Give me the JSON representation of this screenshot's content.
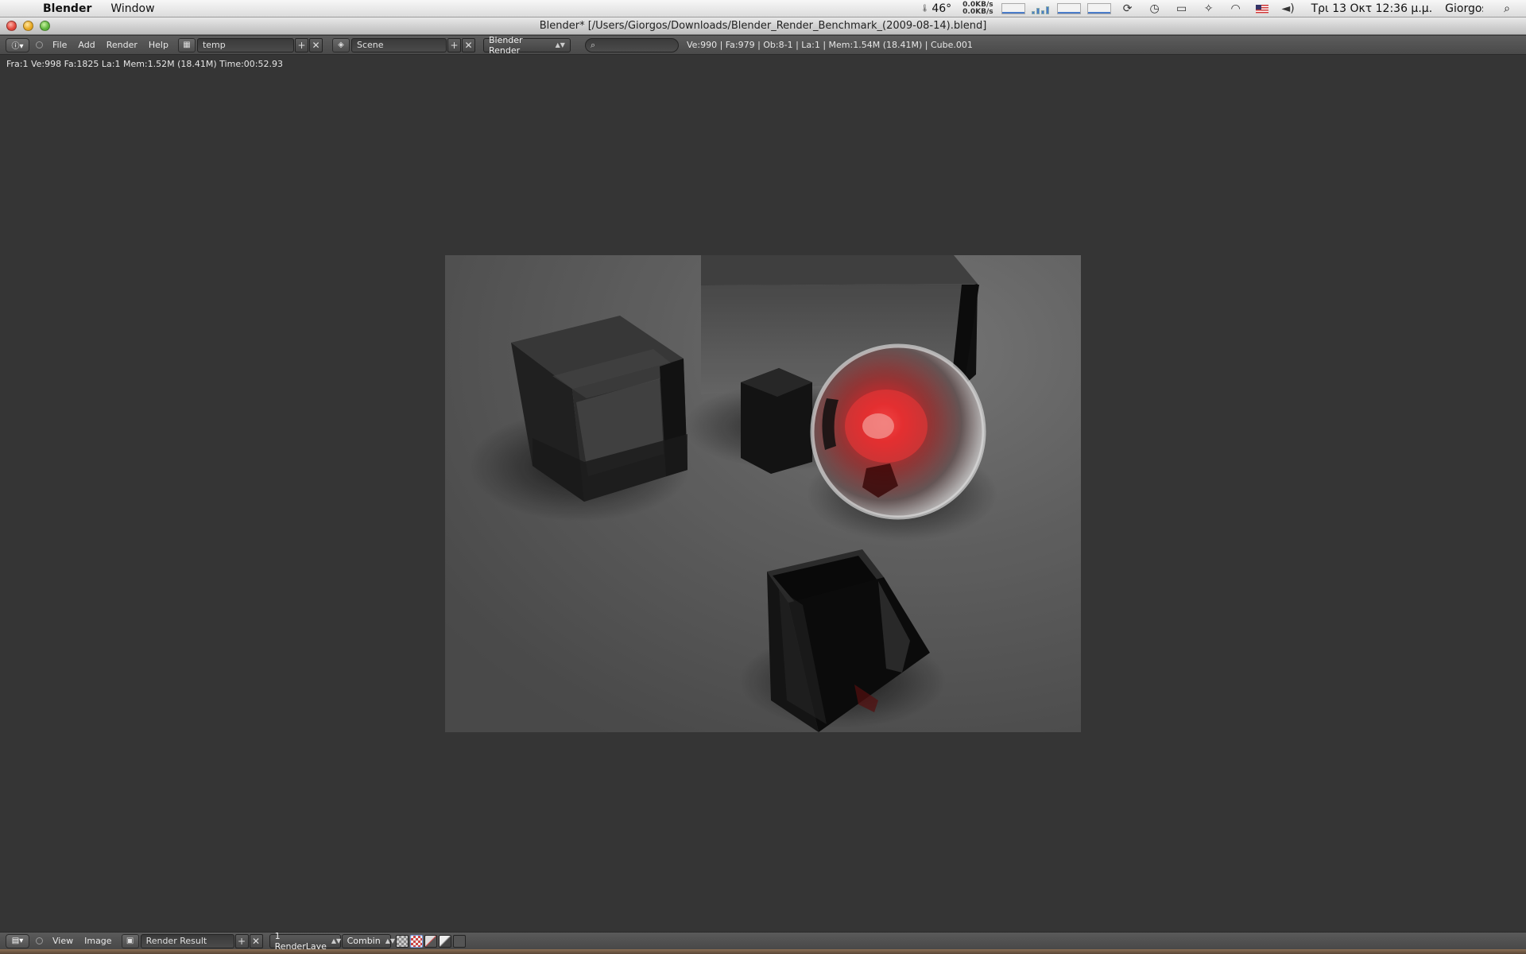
{
  "menubar": {
    "app_name": "Blender",
    "menus": [
      "Window"
    ],
    "temperature": "46°",
    "net_up": "0.0KB/s",
    "net_down": "0.0KB/s",
    "datetime": "Τρι 13 Οκτ  12:36 μ.μ.",
    "user": "Giorgos"
  },
  "window": {
    "title": "Blender* [/Users/Giorgos/Downloads/Blender_Render_Benchmark_(2009-08-14).blend]"
  },
  "info_header": {
    "menus": [
      "File",
      "Add",
      "Render",
      "Help"
    ],
    "screen_layout": "temp",
    "scene": "Scene",
    "render_engine": "Blender Render",
    "search_placeholder": "",
    "stats": "Ve:990 | Fa:979 | Ob:8-1 | La:1 | Mem:1.54M (18.41M) | Cube.001"
  },
  "image_editor": {
    "render_stats": "Fra:1  Ve:998 Fa:1825 La:1 Mem:1.52M (18.41M) Time:00:52.93"
  },
  "bottom_header": {
    "menus": [
      "View",
      "Image"
    ],
    "image_name": "Render Result",
    "render_layer": "1 RenderLaye",
    "pass": "Combin"
  },
  "icons": {
    "apple": "apple-logo",
    "wifi": "wifi-icon",
    "volume": "volume-icon",
    "search": "spotlight-icon",
    "sync": "sync-icon",
    "time_machine": "time-machine-icon",
    "display": "display-icon",
    "bluetooth": "bluetooth-icon"
  },
  "colors": {
    "sphere_red": "#e0282c",
    "editor_bg": "#353535",
    "header_bg": "#4a4a4a"
  }
}
